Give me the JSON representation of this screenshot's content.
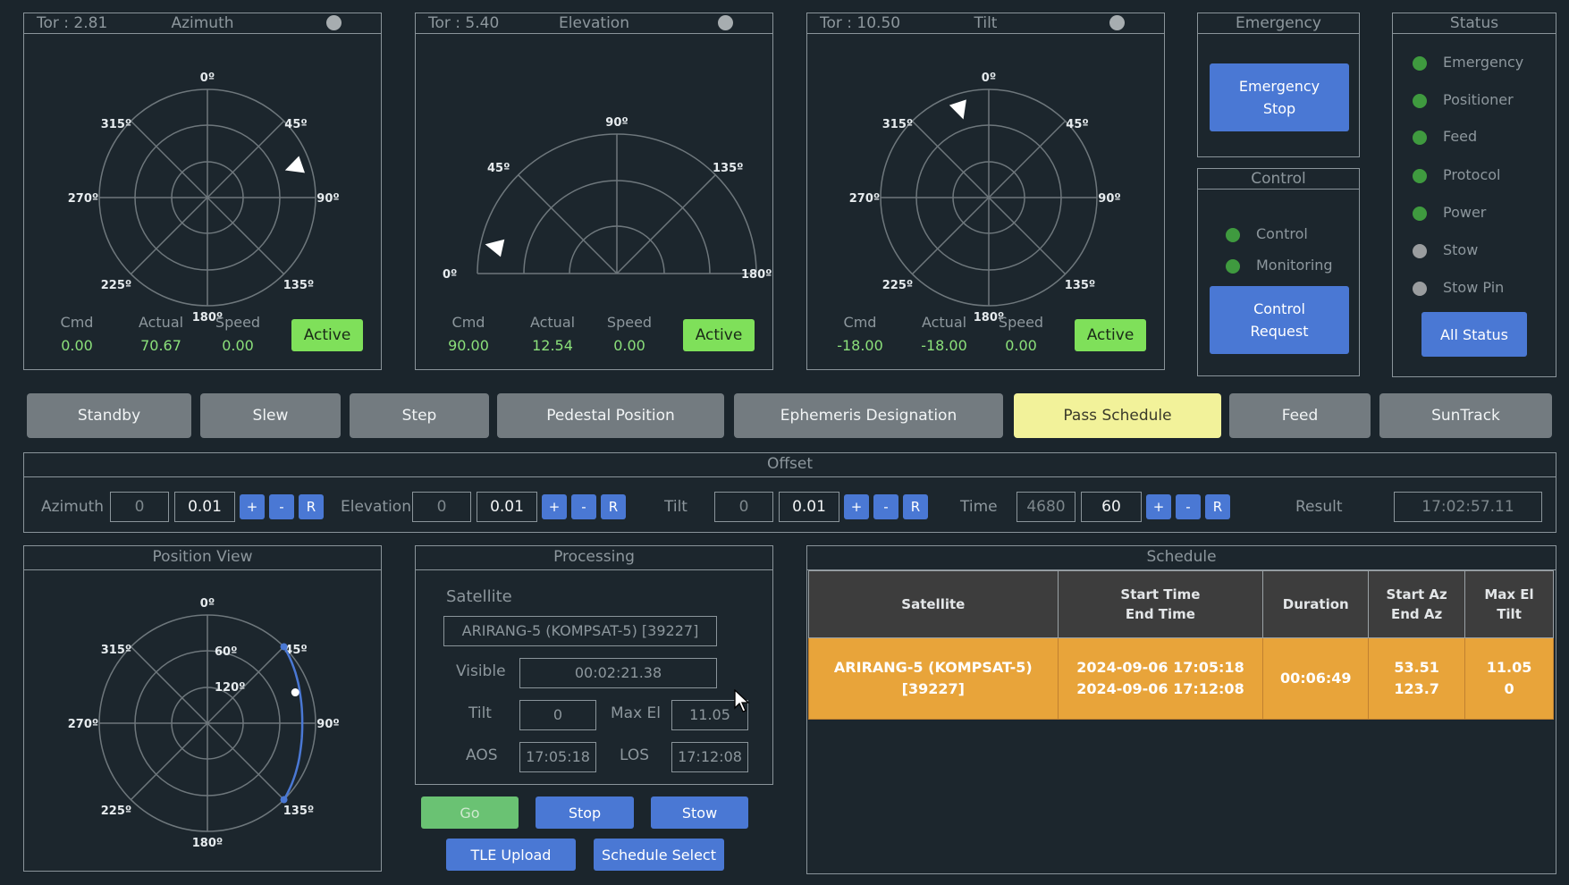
{
  "axes": [
    {
      "tor": "Tor : 2.81",
      "title": "Azimuth",
      "cmd_label": "Cmd",
      "actual_label": "Actual",
      "speed_label": "Speed",
      "cmd": "0.00",
      "actual": "70.67",
      "speed": "0.00",
      "state": "Active",
      "pointer_deg": 70.67
    },
    {
      "tor": "Tor : 5.40",
      "title": "Elevation",
      "cmd_label": "Cmd",
      "actual_label": "Actual",
      "speed_label": "Speed",
      "cmd": "90.00",
      "actual": "12.54",
      "speed": "0.00",
      "state": "Active",
      "pointer_deg": 12.54
    },
    {
      "tor": "Tor : 10.50",
      "title": "Tilt",
      "cmd_label": "Cmd",
      "actual_label": "Actual",
      "speed_label": "Speed",
      "cmd": "-18.00",
      "actual": "-18.00",
      "speed": "0.00",
      "state": "Active",
      "pointer_deg": -18
    }
  ],
  "compass_labels": {
    "n": "0º",
    "ne": "45º",
    "e": "90º",
    "se": "135º",
    "s": "180º",
    "sw": "225º",
    "w": "270º",
    "nw": "315º"
  },
  "elev_labels": {
    "e0": "0º",
    "e45": "45º",
    "e90": "90º",
    "e135": "135º",
    "e180": "180º"
  },
  "emergency": {
    "title": "Emergency",
    "button_l1": "Emergency",
    "button_l2": "Stop"
  },
  "control": {
    "title": "Control",
    "items": [
      {
        "label": "Control",
        "color": "#3f9a3f"
      },
      {
        "label": "Monitoring",
        "color": "#3f9a3f"
      }
    ],
    "button_l1": "Control",
    "button_l2": "Request"
  },
  "status": {
    "title": "Status",
    "items": [
      {
        "label": "Emergency",
        "color": "#3f9a3f"
      },
      {
        "label": "Positioner",
        "color": "#3f9a3f"
      },
      {
        "label": "Feed",
        "color": "#3f9a3f"
      },
      {
        "label": "Protocol",
        "color": "#3f9a3f"
      },
      {
        "label": "Power",
        "color": "#3f9a3f"
      },
      {
        "label": "Stow",
        "color": "#9a9d9f"
      },
      {
        "label": "Stow Pin",
        "color": "#9a9d9f"
      }
    ],
    "all_button": "All Status"
  },
  "modes": [
    "Standby",
    "Slew",
    "Step",
    "Pedestal Position",
    "Ephemeris Designation",
    "Pass Schedule",
    "Feed",
    "SunTrack"
  ],
  "selected_mode": "Pass Schedule",
  "offset": {
    "title": "Offset",
    "azimuth": {
      "label": "Azimuth",
      "value": "0",
      "step": "0.01"
    },
    "elevation": {
      "label": "Elevation",
      "value": "0",
      "step": "0.01"
    },
    "tilt": {
      "label": "Tilt",
      "value": "0",
      "step": "0.01"
    },
    "time": {
      "label": "Time",
      "value": "4680",
      "step": "60"
    },
    "plus": "+",
    "minus": "-",
    "reset": "R",
    "result_label": "Result",
    "result": "17:02:57.11"
  },
  "position_view": {
    "title": "Position View",
    "ring_60": "60º",
    "ring_120": "120º",
    "track_start_az": 45,
    "track_end_az": 135,
    "track_max_el": 11.05,
    "current_az": 70.67,
    "current_el": 12.54
  },
  "processing": {
    "title": "Processing",
    "satellite_label": "Satellite",
    "satellite": "ARIRANG-5 (KOMPSAT-5) [39227]",
    "visible_label": "Visible",
    "visible": "00:02:21.38",
    "tilt_label": "Tilt",
    "tilt": "0",
    "maxel_label": "Max El",
    "maxel": "11.05",
    "aos_label": "AOS",
    "aos": "17:05:18",
    "los_label": "LOS",
    "los": "17:12:08",
    "go": "Go",
    "stop": "Stop",
    "stow": "Stow",
    "tle_upload": "TLE Upload",
    "schedule_select": "Schedule Select"
  },
  "schedule": {
    "title": "Schedule",
    "headers": [
      [
        "Satellite"
      ],
      [
        "Start Time",
        "End Time"
      ],
      [
        "Duration"
      ],
      [
        "Start Az",
        "End Az"
      ],
      [
        "Max El",
        "Tilt"
      ]
    ],
    "rows": [
      {
        "satellite_l1": "ARIRANG-5 (KOMPSAT-5)",
        "satellite_l2": "[39227]",
        "start": "2024-09-06 17:05:18",
        "end": "2024-09-06 17:12:08",
        "duration": "00:06:49",
        "start_az": "53.51",
        "end_az": "123.7",
        "max_el": "11.05",
        "tilt": "0"
      }
    ]
  }
}
